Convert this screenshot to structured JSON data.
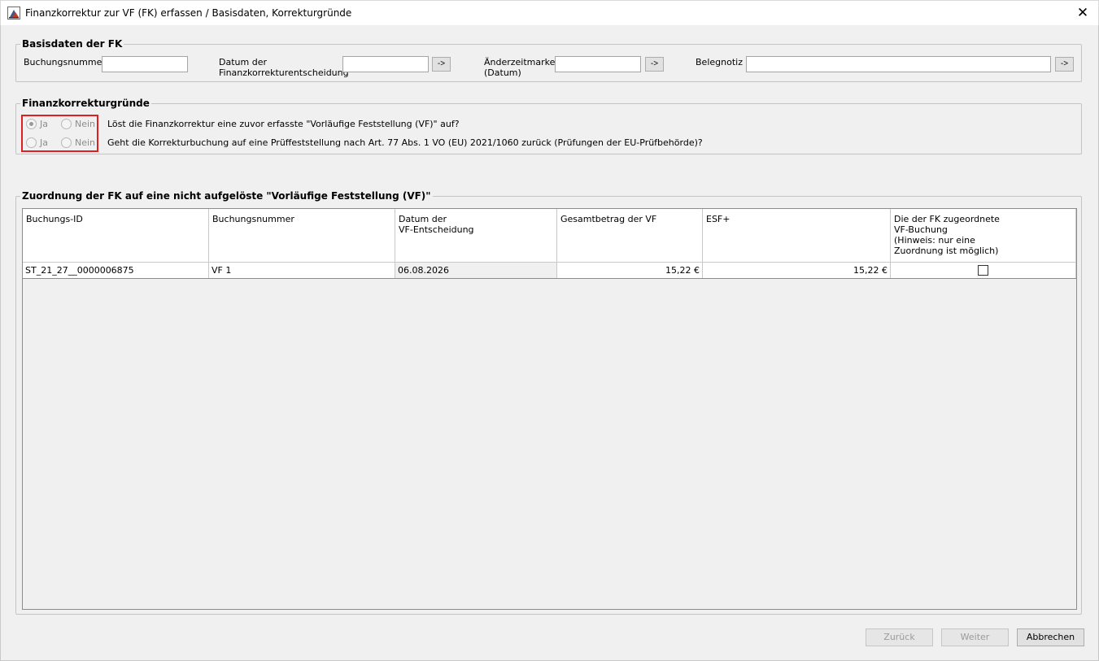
{
  "window": {
    "title": "Finanzkorrektur zur VF (FK) erfassen / Basisdaten, Korrekturgründe",
    "close_glyph": "✕"
  },
  "basisdaten": {
    "group_title": "Basisdaten der FK",
    "buchungsnummer_label": "Buchungsnummer",
    "buchungsnummer_value": "",
    "datum_label": "Datum der\nFinanzkorrekturentscheidung",
    "datum_value": "",
    "aenderung_label": "Änderzeitmarke\n(Datum)",
    "aenderung_value": "",
    "belegnotiz_label": "Belegnotiz",
    "belegnotiz_value": "",
    "arrow_label": "->"
  },
  "gruende": {
    "group_title": "Finanzkorrekturgründe",
    "yes_label": "Ja",
    "no_label": "Nein",
    "q1": {
      "text": "Löst die Finanzkorrektur eine zuvor erfasste \"Vorläufige Feststellung (VF)\" auf?",
      "selected": "Ja",
      "enabled": false
    },
    "q2": {
      "text": "Geht die Korrekturbuchung auf eine Prüffeststellung nach Art. 77 Abs. 1 VO (EU) 2021/1060 zurück (Prüfungen der EU-Prüfbehörde)?",
      "selected": "",
      "enabled": false
    },
    "highlight_color": "#e02020"
  },
  "zuordnung": {
    "group_title": "Zuordnung der FK auf eine nicht aufgelöste \"Vorläufige Feststellung (VF)\"",
    "columns": [
      "Buchungs-ID",
      "Buchungsnummer",
      "Datum der\nVF-Entscheidung",
      "Gesamtbetrag der VF",
      "ESF+",
      "Die der FK zugeordnete\nVF-Buchung\n(Hinweis: nur eine\nZuordnung ist möglich)"
    ],
    "rows": [
      {
        "buchungs_id": "ST_21_27__0000006875",
        "buchungsnummer": "VF 1",
        "datum": "06.08.2026",
        "gesamtbetrag": "15,22 €",
        "esf": "15,22 €",
        "zugeordnet": false
      }
    ]
  },
  "footer": {
    "back_label": "Zurück",
    "next_label": "Weiter",
    "cancel_label": "Abbrechen"
  }
}
